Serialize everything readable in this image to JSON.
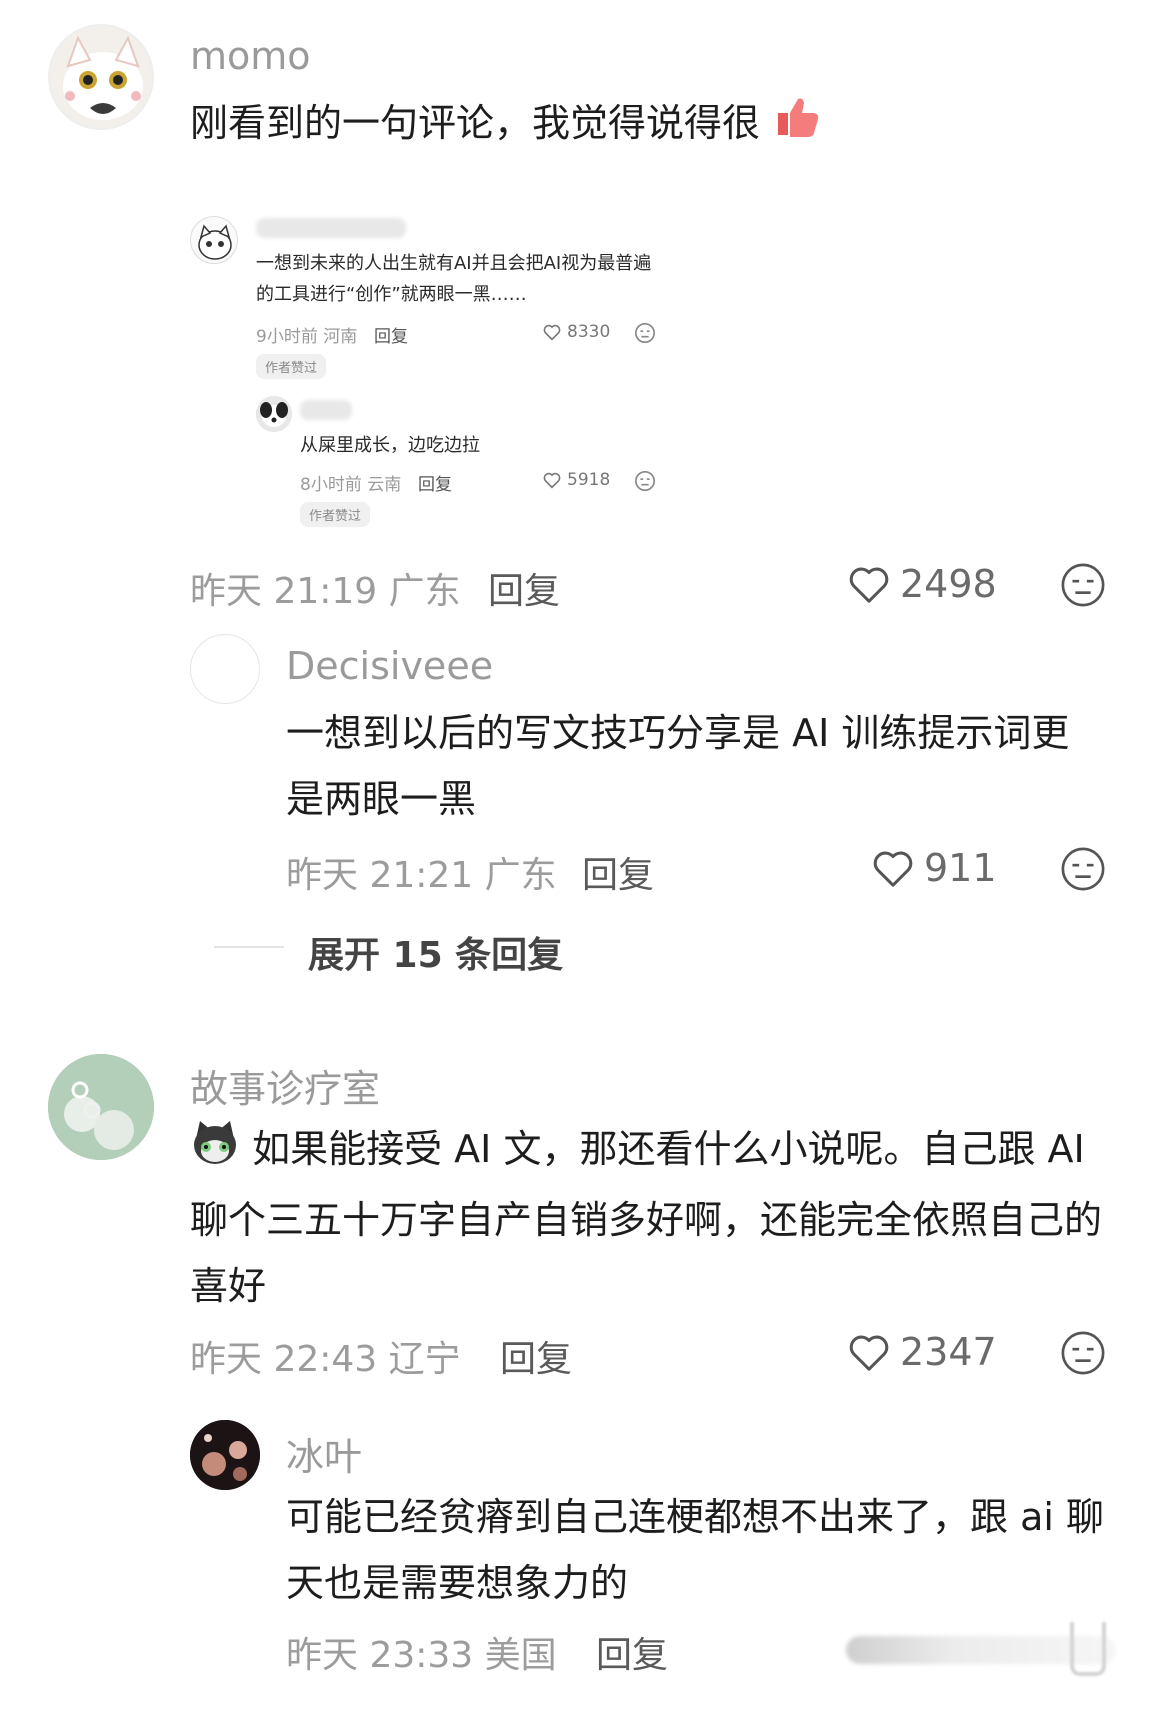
{
  "comments": [
    {
      "username": "momo",
      "text": "刚看到的一句评论，我觉得说得很",
      "emoji": "thumbs-up",
      "time": "昨天 21:19 广东",
      "reply_label": "回复",
      "likes": "2498",
      "embedded": {
        "comment_text": "一想到未来的人出生就有AI并且会把AI视为最普遍的工具进行“创作”就两眼一黑……",
        "meta": "9小时前 河南",
        "reply_label": "回复",
        "likes": "8330",
        "badge": "作者赞过",
        "reply": {
          "text": "从屎里成长，边吃边拉",
          "meta": "8小时前 云南",
          "reply_label": "回复",
          "likes": "5918",
          "badge": "作者赞过"
        }
      },
      "replies": [
        {
          "username": "Decisiveee",
          "text": "一想到以后的写文技巧分享是 AI 训练提示词更是两眼一黑",
          "time": "昨天 21:21 广东",
          "reply_label": "回复",
          "likes": "911"
        }
      ],
      "expand_label": "展开 15 条回复"
    },
    {
      "username": "故事诊疗室",
      "text": "如果能接受 AI 文，那还看什么小说呢。自己跟 AI 聊个三五十万字自产自销多好啊，还能完全依照自己的喜好",
      "emoji": "cat-face",
      "time": "昨天 22:43 辽宁",
      "reply_label": "回复",
      "likes": "2347",
      "replies": [
        {
          "username": "冰叶",
          "text": "可能已经贫瘠到自己连梗都想不出来了，跟 ai 聊天也是需要想象力的",
          "time": "昨天 23:33 美国",
          "reply_label": "回复"
        }
      ]
    }
  ],
  "colors": {
    "muted": "#9a9a9a",
    "text": "#1d1d1d",
    "thumb": "#f06a6a"
  }
}
